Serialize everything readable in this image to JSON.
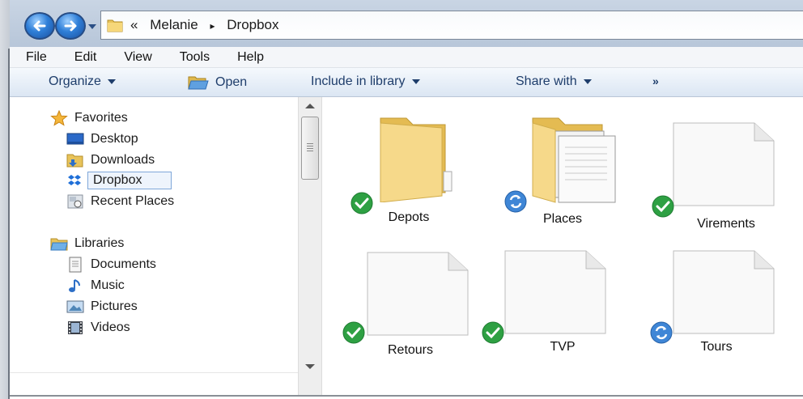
{
  "address": {
    "path": [
      "«",
      "Melanie",
      "▸",
      "Dropbox"
    ]
  },
  "menu": {
    "file": "File",
    "edit": "Edit",
    "view": "View",
    "tools": "Tools",
    "help": "Help"
  },
  "toolbar": {
    "organize": "Organize",
    "open": "Open",
    "include": "Include in library",
    "share": "Share with",
    "more": "»"
  },
  "nav": {
    "favorites": "Favorites",
    "desktop": "Desktop",
    "downloads": "Downloads",
    "dropbox": "Dropbox",
    "recent": "Recent Places",
    "libraries": "Libraries",
    "documents": "Documents",
    "music": "Music",
    "pictures": "Pictures",
    "videos": "Videos"
  },
  "files": [
    {
      "name": "Depots",
      "kind": "folder",
      "status": "synced"
    },
    {
      "name": "Places",
      "kind": "folder-with-files",
      "status": "syncing"
    },
    {
      "name": "Virements",
      "kind": "document",
      "status": "synced"
    },
    {
      "name": "Retours",
      "kind": "document",
      "status": "synced"
    },
    {
      "name": "TVP",
      "kind": "document",
      "status": "synced"
    },
    {
      "name": "Tours",
      "kind": "document",
      "status": "syncing"
    }
  ],
  "colors": {
    "synced": "#2ea043",
    "syncing": "#3f86d6",
    "folder": "#f2cf6b",
    "toolbar_text": "#1e3d6b"
  },
  "icons": {
    "back": "back-arrow-icon",
    "forward": "forward-arrow-icon",
    "synced": "checkmark-icon",
    "syncing": "sync-icon"
  }
}
